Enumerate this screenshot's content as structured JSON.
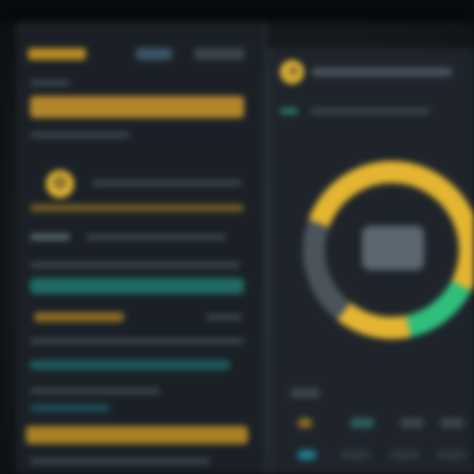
{
  "colors": {
    "background": "#0c1014",
    "panel": "#1a2026",
    "accent_yellow": "#e3b531",
    "accent_teal": "#1f9e83",
    "accent_green": "#2fbf7a",
    "muted": "#3b444d"
  },
  "icons": {
    "settings": "gear-icon",
    "panel": "gauge-icon"
  },
  "gauge": {
    "segments": [
      {
        "color": "#e3b531",
        "fraction": 0.52
      },
      {
        "color": "#2fbf7a",
        "fraction": 0.14
      },
      {
        "color": "#e3b531",
        "fraction": 0.14
      },
      {
        "color": "#4b535b",
        "fraction": 0.2
      }
    ]
  }
}
